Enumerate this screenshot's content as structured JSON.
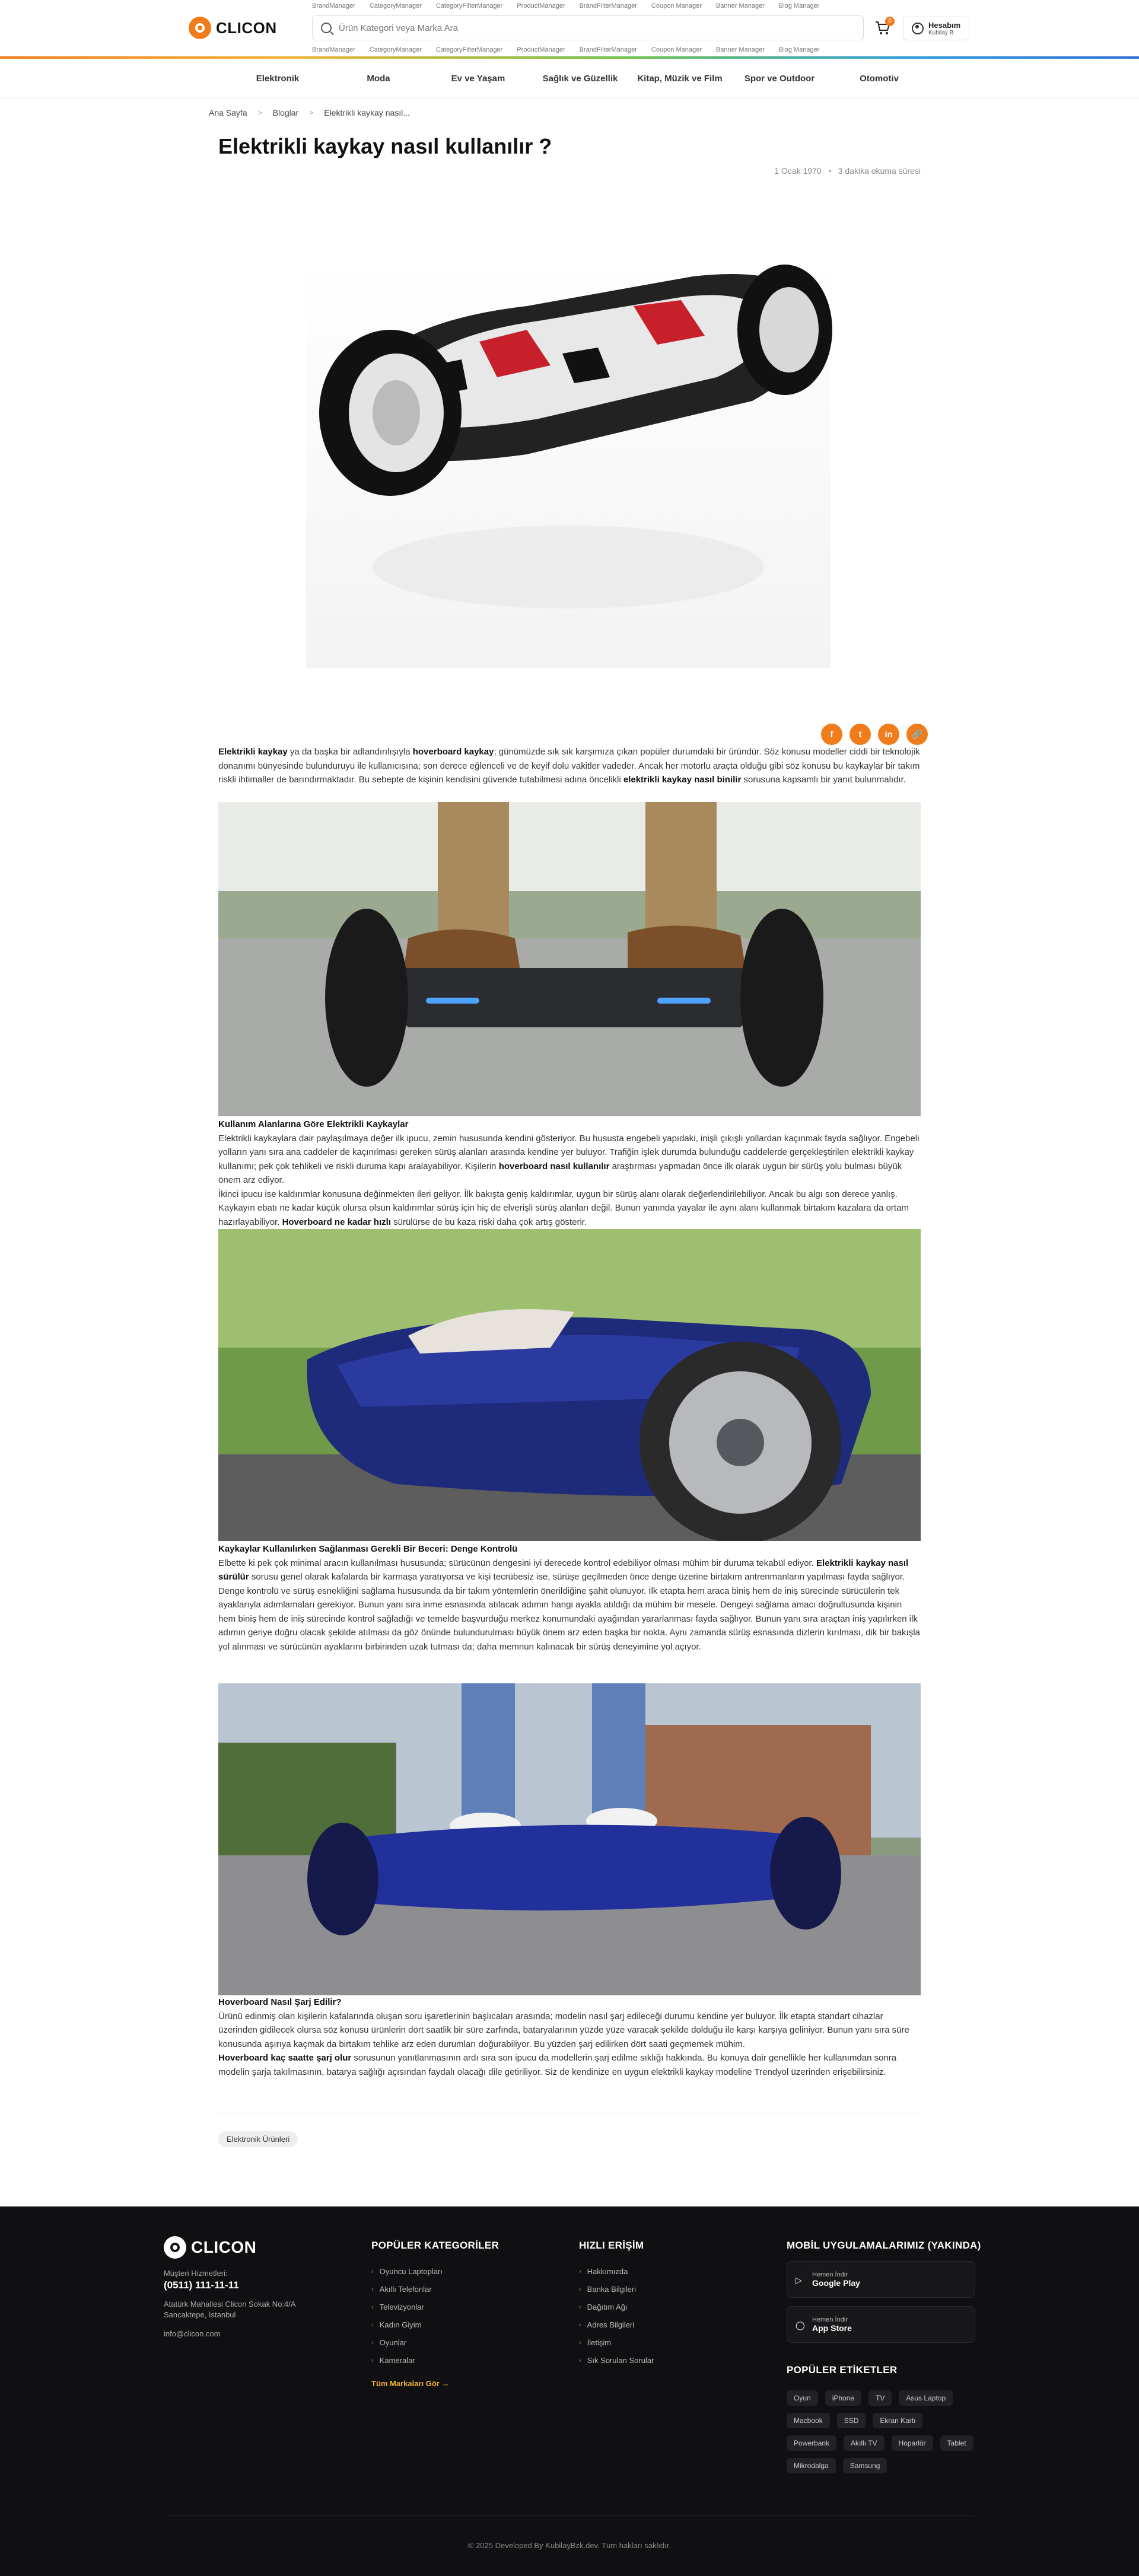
{
  "header": {
    "logo_text": "CLICON",
    "manager_links_top": [
      "BrandManager",
      "CategoryManager",
      "CategoryFilterManager",
      "ProductManager",
      "BrandFilterManager",
      "Coupon Manager",
      "Banner Manager",
      "Blog Manager"
    ],
    "manager_links_bottom": [
      "BrandManager",
      "CategoryManager",
      "CategoryFilterManager",
      "ProductManager",
      "BrandFilterManager",
      "Coupon Manager",
      "Banner Manager",
      "Blog Manager"
    ],
    "search_placeholder": "Ürün Kategori veya Marka Ara",
    "cart_count": "0",
    "account_title": "Hesabım",
    "account_sub": "Kubilay B."
  },
  "nav": {
    "categories": [
      "Elektronik",
      "Moda",
      "Ev ve Yaşam",
      "Sağlık ve Güzellik",
      "Kitap, Müzik ve Film",
      "Spor ve Outdoor",
      "Otomotiv"
    ]
  },
  "breadcrumb": [
    "Ana Sayfa",
    "Bloglar",
    "Elektrikli kaykay nasıl..."
  ],
  "article": {
    "title": "Elektrikli kaykay nasıl kullanılır ?",
    "date": "1 Ocak 1970",
    "read_time": "3 dakika okuma süresi",
    "share_icons": [
      "facebook-icon",
      "twitter-icon",
      "linkedin-icon",
      "link-icon"
    ],
    "p1_bold1": "Elektrikli kaykay",
    "p1_t1": " ya da başka bir adlandırılışıyla ",
    "p1_bold2": "hoverboard kaykay",
    "p1_t2": "; günümüzde sık sık karşımıza çıkan popüler durumdaki bir üründür. Söz konusu modeller ciddi bir teknolojik donanımı bünyesinde bulunduruyu ile kullanıcısına; son derece eğlenceli ve de keyif dolu vakitler vadeder. Ancak her motorlu araçta olduğu gibi söz konusu bu kaykaylar bir takım riskli ihtimaller de barındırmaktadır. Bu sebepte de kişinin kendisini güvende tutabilmesi adına öncelikli ",
    "p1_bold3": "elektrikli kaykay nasıl binilir",
    "p1_t3": " sorusuna kapsamlı bir yanıt bulunmalıdır.",
    "h2": "Kullanım Alanlarına Göre Elektrikli Kaykaylar",
    "p2_t1": "Elektrikli kaykaylara dair paylaşılmaya değer ilk ipucu, zemin hususunda kendini gösteriyor. Bu hususta engebeli yapıdaki, inişli çıkışlı yollardan kaçınmak fayda sağlıyor. Engebeli yolların yanı sıra ana caddeler de kaçınılması gereken sürüş alanları arasında kendine yer buluyor. Trafiğin işlek durumda bulunduğu caddelerde gerçekleştirilen elektrikli kaykay kullanımı; pek çok tehlikeli ve riskli duruma kapı aralayabiliyor. Kişilerin ",
    "p2_bold1": "hoverboard nasıl kullanılır",
    "p2_t2": " araştırması yapmadan önce ilk olarak uygun bir sürüş yolu bulması büyük önem arz ediyor.",
    "p3_t1": "İkinci ipucu ise kaldırımlar konusuna değinmekten ileri geliyor. İlk bakışta geniş kaldırımlar, uygun bir sürüş alanı olarak değerlendirilebiliyor. Ancak bu algı son derece yanlış. Kaykayın ebatı ne kadar küçük olursa olsun kaldırımlar sürüş için hiç de elverişli sürüş alanları değil. Bunun yanında yayalar ile aynı alanı kullanmak birtakım kazalara da ortam hazırlayabiliyor. ",
    "p3_bold1": "Hoverboard ne kadar hızlı",
    "p3_t2": " sürülürse de bu kaza riski daha çok artış gösterir.",
    "h3": "Kaykaylar Kullanılırken Sağlanması Gerekli Bir Beceri: Denge Kontrolü",
    "p4_t1": "Elbette ki pek çok minimal aracın kullanılması hususunda; sürücünün dengesini iyi derecede kontrol edebiliyor olması mühim bir duruma tekabül ediyor. ",
    "p4_bold1": "Elektrikli kaykay nasıl sürülür",
    "p4_t2": " sorusu genel olarak kafalarda bir karmaşa yaratıyorsa ve kişi tecrübesiz ise, sürüşe geçilmeden önce denge üzerine birtakım antrenmanların yapılması fayda sağlıyor.",
    "p5": "Denge kontrolü ve sürüş esnekliğini sağlama hususunda da bir takım yöntemlerin önerildiğine şahit olunuyor. İlk etapta hem araca biniş hem de iniş sürecinde sürücülerin tek ayaklarıyla adımlamaları gerekiyor. Bunun yanı sıra inme esnasında atılacak adımın hangi ayakla atıldığı da mühim bir mesele. Dengeyi sağlama amacı doğrultusunda kişinin hem biniş hem de iniş sürecinde kontrol sağladığı ve temelde başvurduğu merkez konumundaki ayağından yararlanması fayda sağlıyor. Bunun yanı sıra araçtan iniş yapılırken ilk adımın geriye doğru olacak şekilde atılması da göz önünde bulundurulması büyük önem arz eden başka bir nokta. Aynı zamanda sürüş esnasında dizlerin kırılması, dik bir bakışla yol alınması ve sürücünün ayaklarını birbirinden uzak tutması da; daha memnun kalınacak bir sürüş deneyimine yol açıyor.",
    "h4": "Hoverboard Nasıl Şarj Edilir?",
    "p6": "Ürünü edinmiş olan kişilerin kafalarında oluşan soru işaretlerinin başlıcaları arasında; modelin nasıl şarj edileceği durumu kendine yer buluyor. İlk etapta standart cihazlar üzerinden gidilecek olursa söz konusu ürünlerin dört saatlik bir süre zarfında, bataryalarının yüzde yüze varacak şekilde dolduğu ile karşı karşıya geliniyor. Bunun yanı sıra süre konusunda aşırıya kaçmak da birtakım tehlike arz eden durumları doğurabiliyor. Bu yüzden şarj edilirken dört saati geçmemek mühim.",
    "p7_bold1": "Hoverboard kaç saatte şarj olur",
    "p7_t1": " sorusunun yanıtlanmasının ardı sıra son ipucu da modellerin şarj edilme sıklığı hakkında. Bu konuya dair genellikle her kullanımdan sonra modelin şarja takılmasının, batarya sağlığı açısından faydalı olacağı dile getiriliyor. Siz de kendinize en uygun elektrikli kaykay modeline Trendyol üzerinden erişebilirsiniz.",
    "tag": "Elektronik Ürünleri"
  },
  "footer": {
    "logo_text": "CLICON",
    "support_label": "Müşteri Hizmetleri:",
    "phone": "(0511) 111-11-11",
    "address_line1": "Atatürk Mahallesi Clicon Sokak No:4/A",
    "address_line2": "Sancaktepe, İstanbul",
    "email": "info@clicon.com",
    "col1_title": "POPÜLER KATEGORİLER",
    "col1_items": [
      "Oyuncu Laptopları",
      "Akıllı Telefonlar",
      "Televizyonlar",
      "Kadın Giyim",
      "Oyunlar",
      "Kameralar"
    ],
    "col1_all": "Tüm Markaları Gör →",
    "col2_title": "HIZLI ERİŞİM",
    "col2_items": [
      "Hakkımızda",
      "Banka Bilgileri",
      "Dağıtım Ağı",
      "Adres Bilgileri",
      "İletişim",
      "Sık Sorulan Sorular"
    ],
    "col3_title": "MOBİL UYGULAMALARIMIZ (YAKINDA)",
    "app1_top": "Hemen İndir",
    "app1_bottom": "Google Play",
    "app2_top": "Hemen İndir",
    "app2_bottom": "App Store",
    "tags_title": "POPÜLER ETİKETLER",
    "tags": [
      "Oyun",
      "iPhone",
      "TV",
      "Asus Laptop",
      "Macbook",
      "SSD",
      "Ekran Kartı",
      "Powerbank",
      "Akıllı TV",
      "Hoparlör",
      "Tablet",
      "Mikrodalga",
      "Samsung"
    ],
    "copyright": "© 2025 Developed By KubilayBzk.dev. Tüm hakları saklıdır."
  }
}
